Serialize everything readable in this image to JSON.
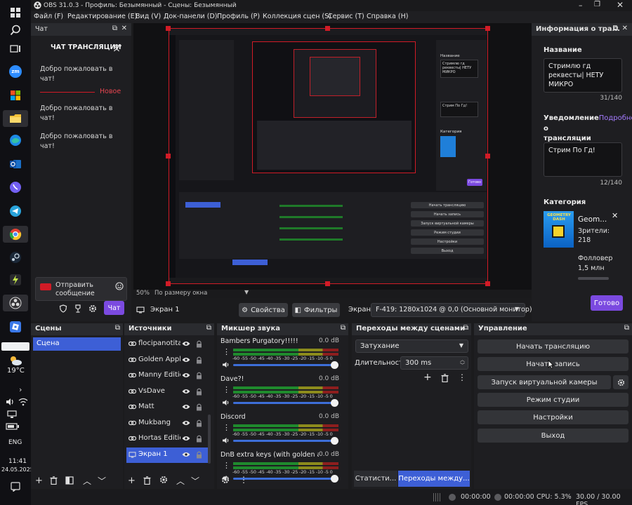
{
  "window": {
    "title": "OBS 31.0.3 - Профиль: Безымянный - Сцены: Безымянный"
  },
  "menu": [
    "Файл (F)",
    "Редактирование (E)",
    "Вид (V)",
    "Док-панели (D)",
    "Профиль (P)",
    "Коллекция сцен (S)",
    "Сервис (T)",
    "Справка (H)"
  ],
  "taskbar": {
    "weather": "19°C",
    "lang": "ENG",
    "time": "11:41",
    "date": "24.05.2025",
    "zoom_label": "zm"
  },
  "chat": {
    "dock_title": "Чат",
    "header": "ЧАТ ТРАНСЛЯЦИИ",
    "messages": [
      "Добро пожаловать в чат!",
      "Добро пожаловать в чат!",
      "Добро пожаловать в чат!"
    ],
    "new_label": "Новое",
    "send_placeholder": "Отправить сообщение",
    "chat_button": "Чат"
  },
  "info": {
    "dock_title": "Информация о тра...",
    "title_label": "Название",
    "title_value": "Стримлю гд реквесты| НЕТУ МИКРО",
    "title_counter": "31/140",
    "notice_label": "Уведомление",
    "notice_link": "Подробнее",
    "notice_label2": "о трансляции",
    "notice_value": "Стрим По Гд!",
    "notice_counter": "12/140",
    "category_label": "Категория",
    "game_name": "Geom...",
    "viewers_label": "Зрители:",
    "viewers": "218",
    "followers_label": "Фолловер",
    "followers": "1,5 млн",
    "done_button": "Готово",
    "game_art_text": "GEOMETRY DASH"
  },
  "preview": {
    "zoom": "50%",
    "fit": "По размеру окна",
    "source_name": "Экран 1",
    "props_button": "Свойства",
    "filters_button": "Фильтры",
    "screen_label": "Экран",
    "screen_value": "F-419: 1280x1024 @ 0,0 (Основной монитор)"
  },
  "scenes": {
    "title": "Сцены",
    "items": [
      "Сцена"
    ]
  },
  "sources": {
    "title": "Источники",
    "items": [
      "flocipanotitac",
      "Golden Apple",
      "Manny Edition",
      "VsDave",
      "Matt",
      "Mukbang",
      "Hortas Edition",
      "Экран 1"
    ]
  },
  "mixer": {
    "title": "Микшер звука",
    "scale": "-60 -55 -50 -45 -40 -35 -30 -25 -20 -15 -10 -5 0",
    "channels": [
      {
        "name": "Bambers Purgatory!!!!!",
        "db": "0.0 dB"
      },
      {
        "name": "Dave?!",
        "db": "0.0 dB"
      },
      {
        "name": "Discord",
        "db": "0.0 dB"
      },
      {
        "name": "DnB extra keys (with golden apple)",
        "db": "0.0 dB"
      }
    ]
  },
  "transitions": {
    "title": "Переходы между сценами",
    "type": "Затухание",
    "duration_label": "Длительность",
    "duration": "300 ms",
    "stats_tab": "Статисти...",
    "trans_tab": "Переходы между..."
  },
  "controls": {
    "title": "Управление",
    "buttons": [
      "Начать трансляцию",
      "Начать запись",
      "Запуск виртуальной камеры",
      "Режим студии",
      "Настройки",
      "Выход"
    ]
  },
  "status": {
    "time1": "00:00:00",
    "time2": "00:00:00",
    "cpu": "CPU: 5.3%",
    "fps": "30.00 / 30.00 FPS"
  },
  "nested": {
    "screen_label": "Экран 1",
    "stream_btn": "Начать трансляцию",
    "rec_btn": "Начать запись",
    "vcam_btn": "Запуск виртуальной камеры",
    "studio_btn": "Режим студии",
    "settings_btn": "Настройки",
    "exit_btn": "Выход",
    "done_btn": "Готово",
    "title_value": "Стримлю гд реквесты| НЕТУ МИКРО",
    "notice_value": "Стрим По Гд!",
    "category_label": "Категория",
    "name_label": "Название"
  },
  "colors": {
    "accent": "#7b4ae0",
    "blue": "#3d5fd6",
    "red": "#d11b26",
    "panel": "#1e1e21"
  }
}
